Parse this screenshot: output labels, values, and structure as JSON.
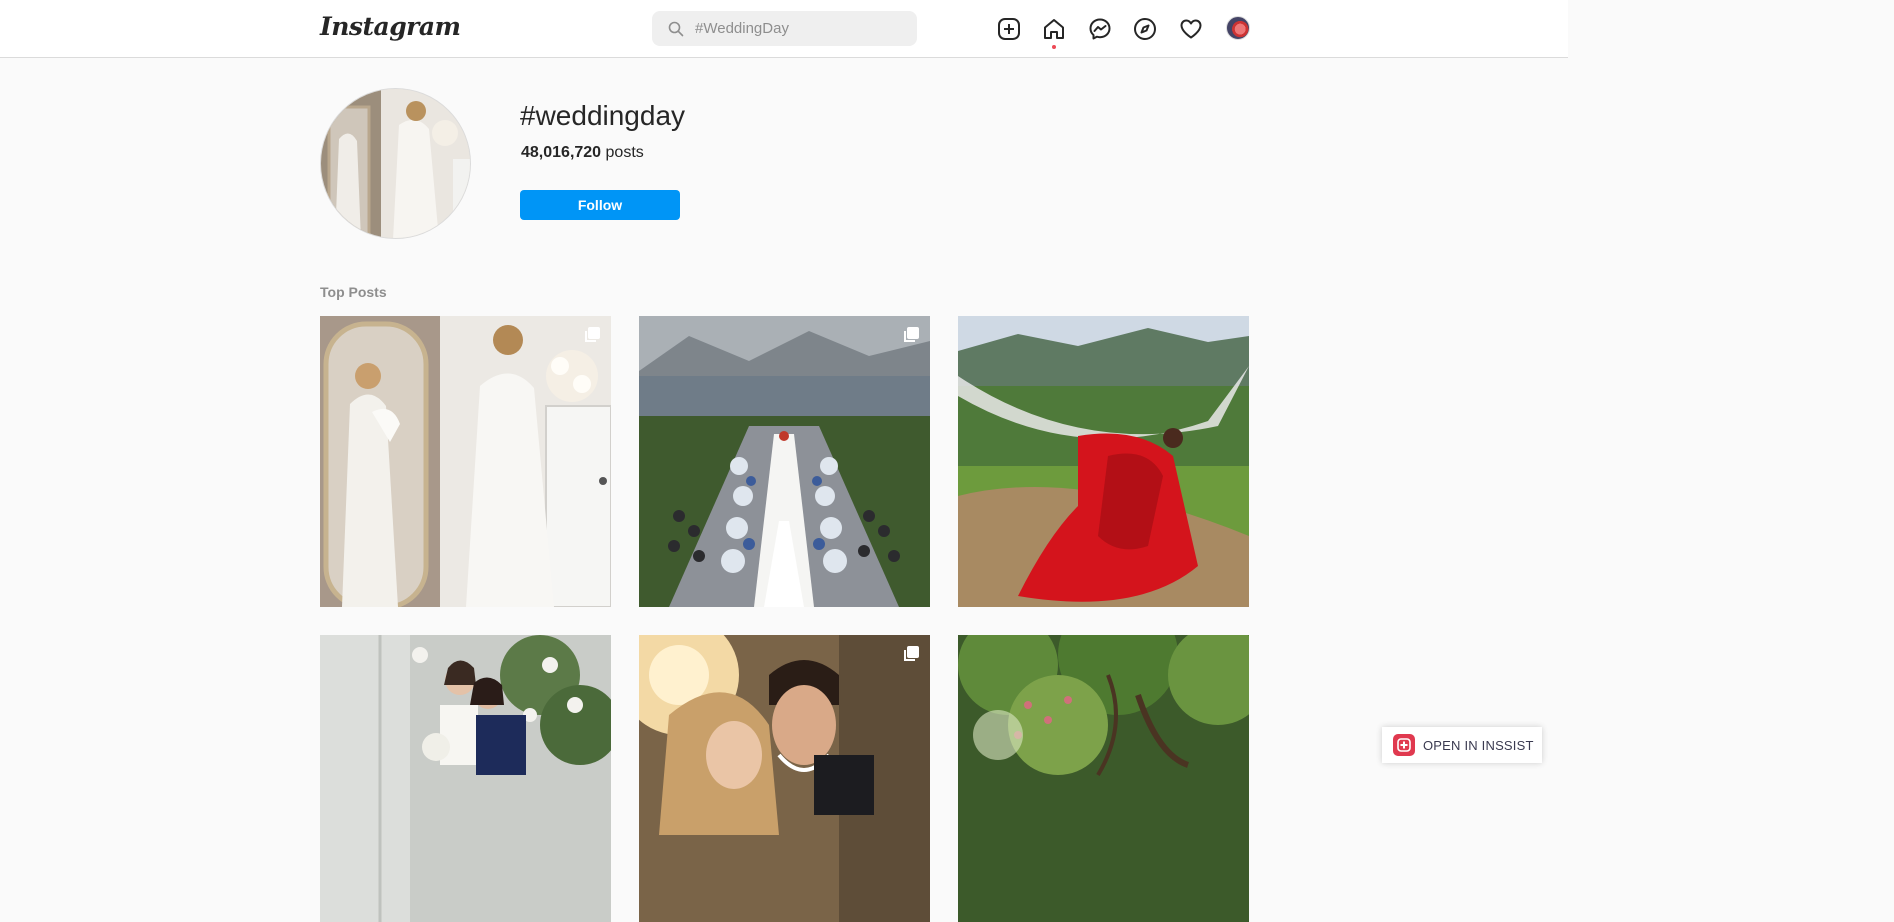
{
  "header": {
    "logo_text": "Instagram",
    "search": {
      "placeholder": "#WeddingDay"
    },
    "nav_icons": [
      "new-post-icon",
      "home-icon",
      "messenger-icon",
      "explore-icon",
      "activity-heart-icon",
      "profile-avatar"
    ],
    "notification_dot_color": "#ed4956"
  },
  "hashtag_page": {
    "title": "#weddingday",
    "post_count": "48,016,720",
    "post_count_suffix": "posts",
    "follow_label": "Follow",
    "follow_color": "#0095f6"
  },
  "top_posts": {
    "section_label": "Top Posts",
    "posts": [
      {
        "subject": "bride in white dress by mirror holding bouquet",
        "multi": true
      },
      {
        "subject": "aerial lakeside wedding ceremony aisle",
        "multi": true
      },
      {
        "subject": "woman in red gown lying in hammock on hillside",
        "multi": false
      },
      {
        "subject": "bride and woman in blue with flower arch",
        "multi": false
      },
      {
        "subject": "couple embracing at sunset",
        "multi": true
      },
      {
        "subject": "garden with trees and greenery",
        "multi": false
      }
    ]
  },
  "extension": {
    "label": "OPEN IN INSSIST",
    "accent": "#e0394f"
  }
}
